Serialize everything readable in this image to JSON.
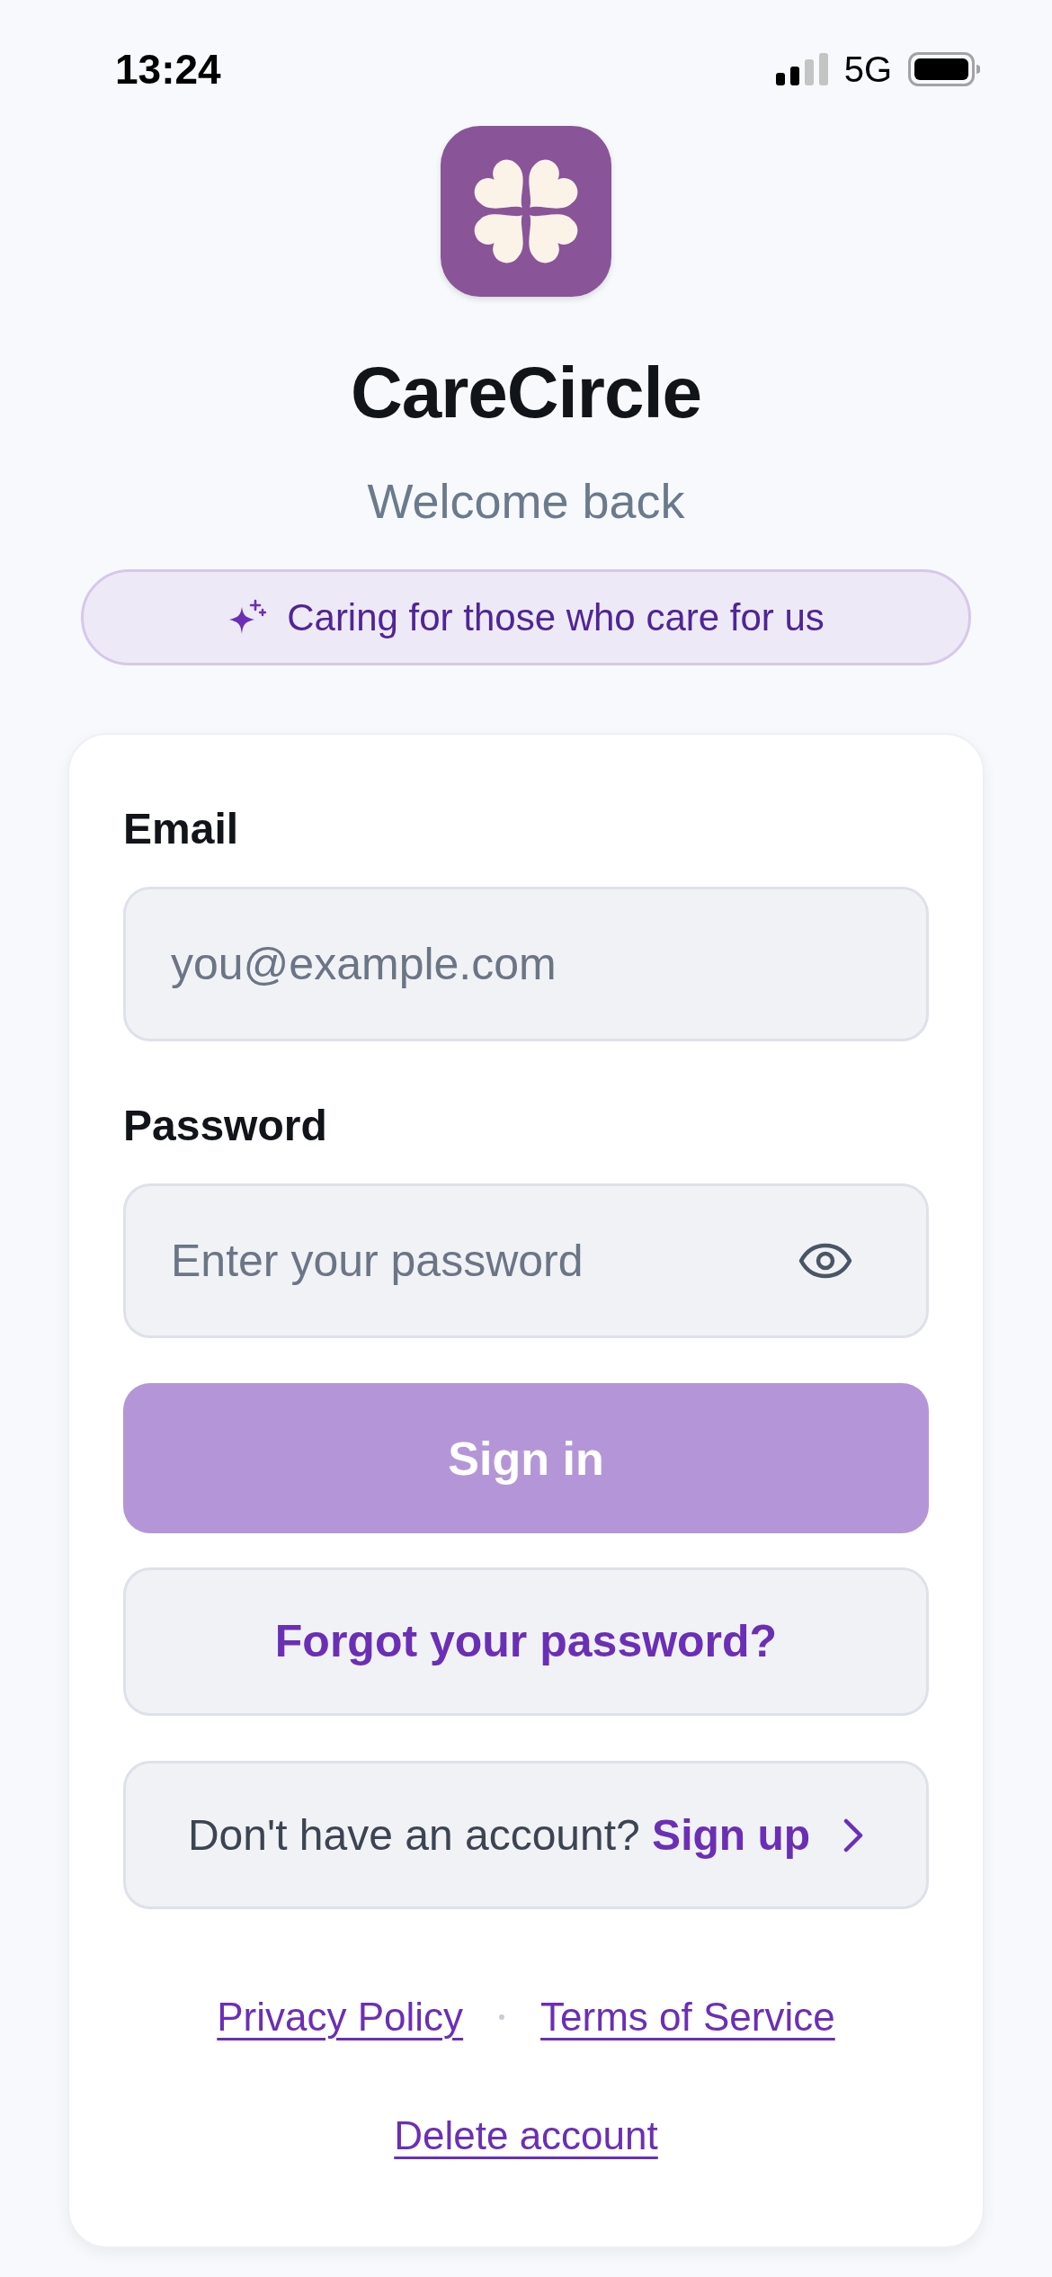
{
  "status_bar": {
    "time": "13:24",
    "network": "5G"
  },
  "header": {
    "app_name": "CareCircle",
    "subtitle": "Welcome back",
    "tagline": "Caring for those who care for us"
  },
  "form": {
    "fields": [
      {
        "kind": "email",
        "label": "Email",
        "placeholder": "you@example.com"
      },
      {
        "kind": "password",
        "label": "Password",
        "placeholder": "Enter your password"
      }
    ],
    "sign_in": {
      "label": "Sign in",
      "disabled": true
    },
    "forgot": {
      "label": "Forgot your password?"
    },
    "sign_up": {
      "prompt": "Don't have an account?",
      "link": "Sign up"
    }
  },
  "footer": {
    "links": [
      "Privacy Policy",
      "Terms of Service"
    ],
    "delete_link": "Delete account"
  }
}
